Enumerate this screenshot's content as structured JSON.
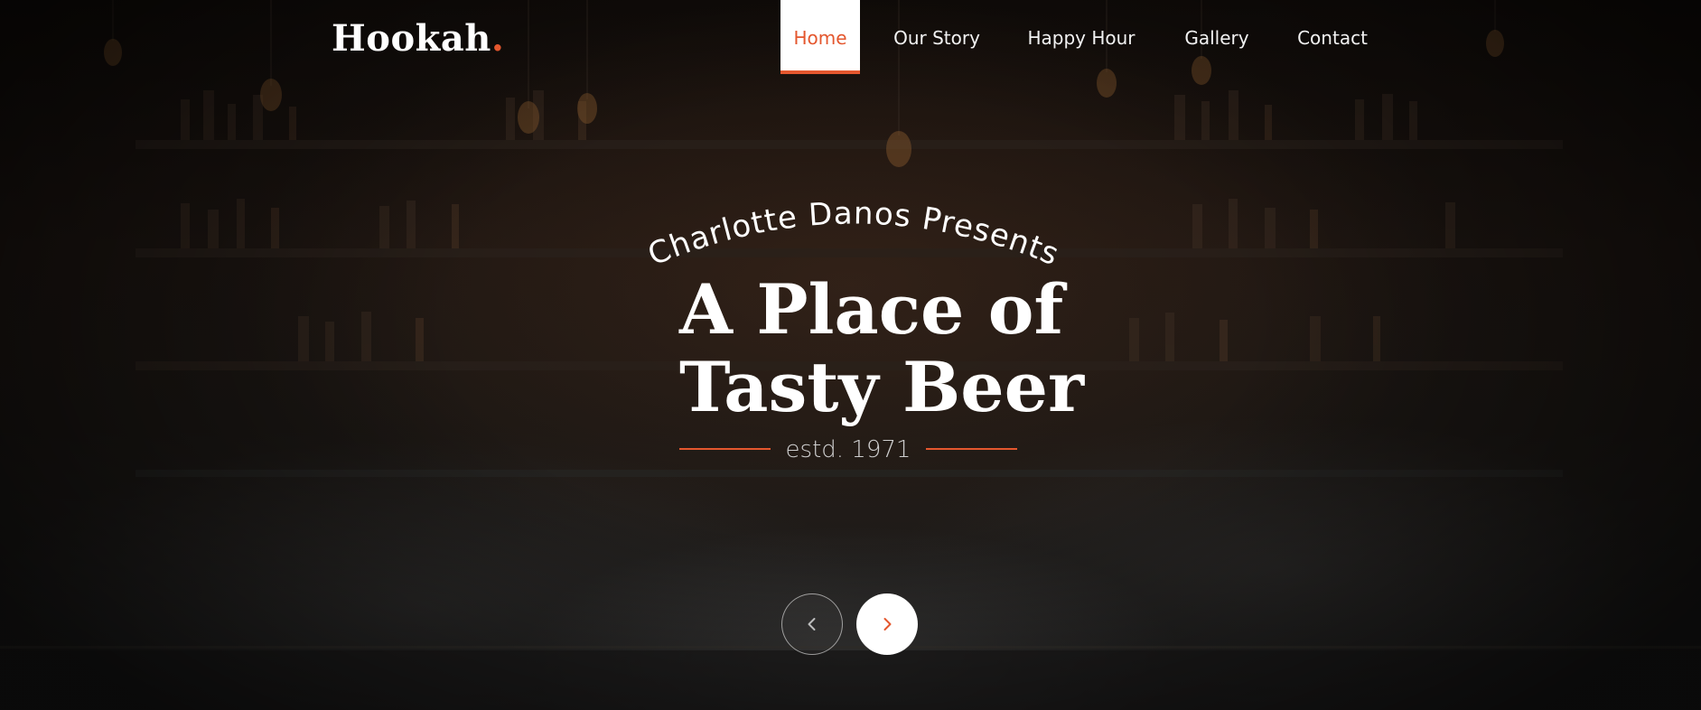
{
  "brand": {
    "name": "Hookah",
    "dot": "."
  },
  "nav": {
    "items": [
      {
        "label": "Home",
        "active": true
      },
      {
        "label": "Our Story",
        "active": false
      },
      {
        "label": "Happy Hour",
        "active": false
      },
      {
        "label": "Gallery",
        "active": false
      },
      {
        "label": "Contact",
        "active": false
      }
    ]
  },
  "hero": {
    "presenter": "Charlotte Danos Presents",
    "title_line1": "A Place of",
    "title_line2": "Tasty Beer",
    "established": "estd. 1971"
  },
  "slider": {
    "prev_icon": "chevron-left-icon",
    "next_icon": "chevron-right-icon"
  },
  "colors": {
    "accent": "#e4572e",
    "background": "#0b0908",
    "text": "#ffffff"
  }
}
